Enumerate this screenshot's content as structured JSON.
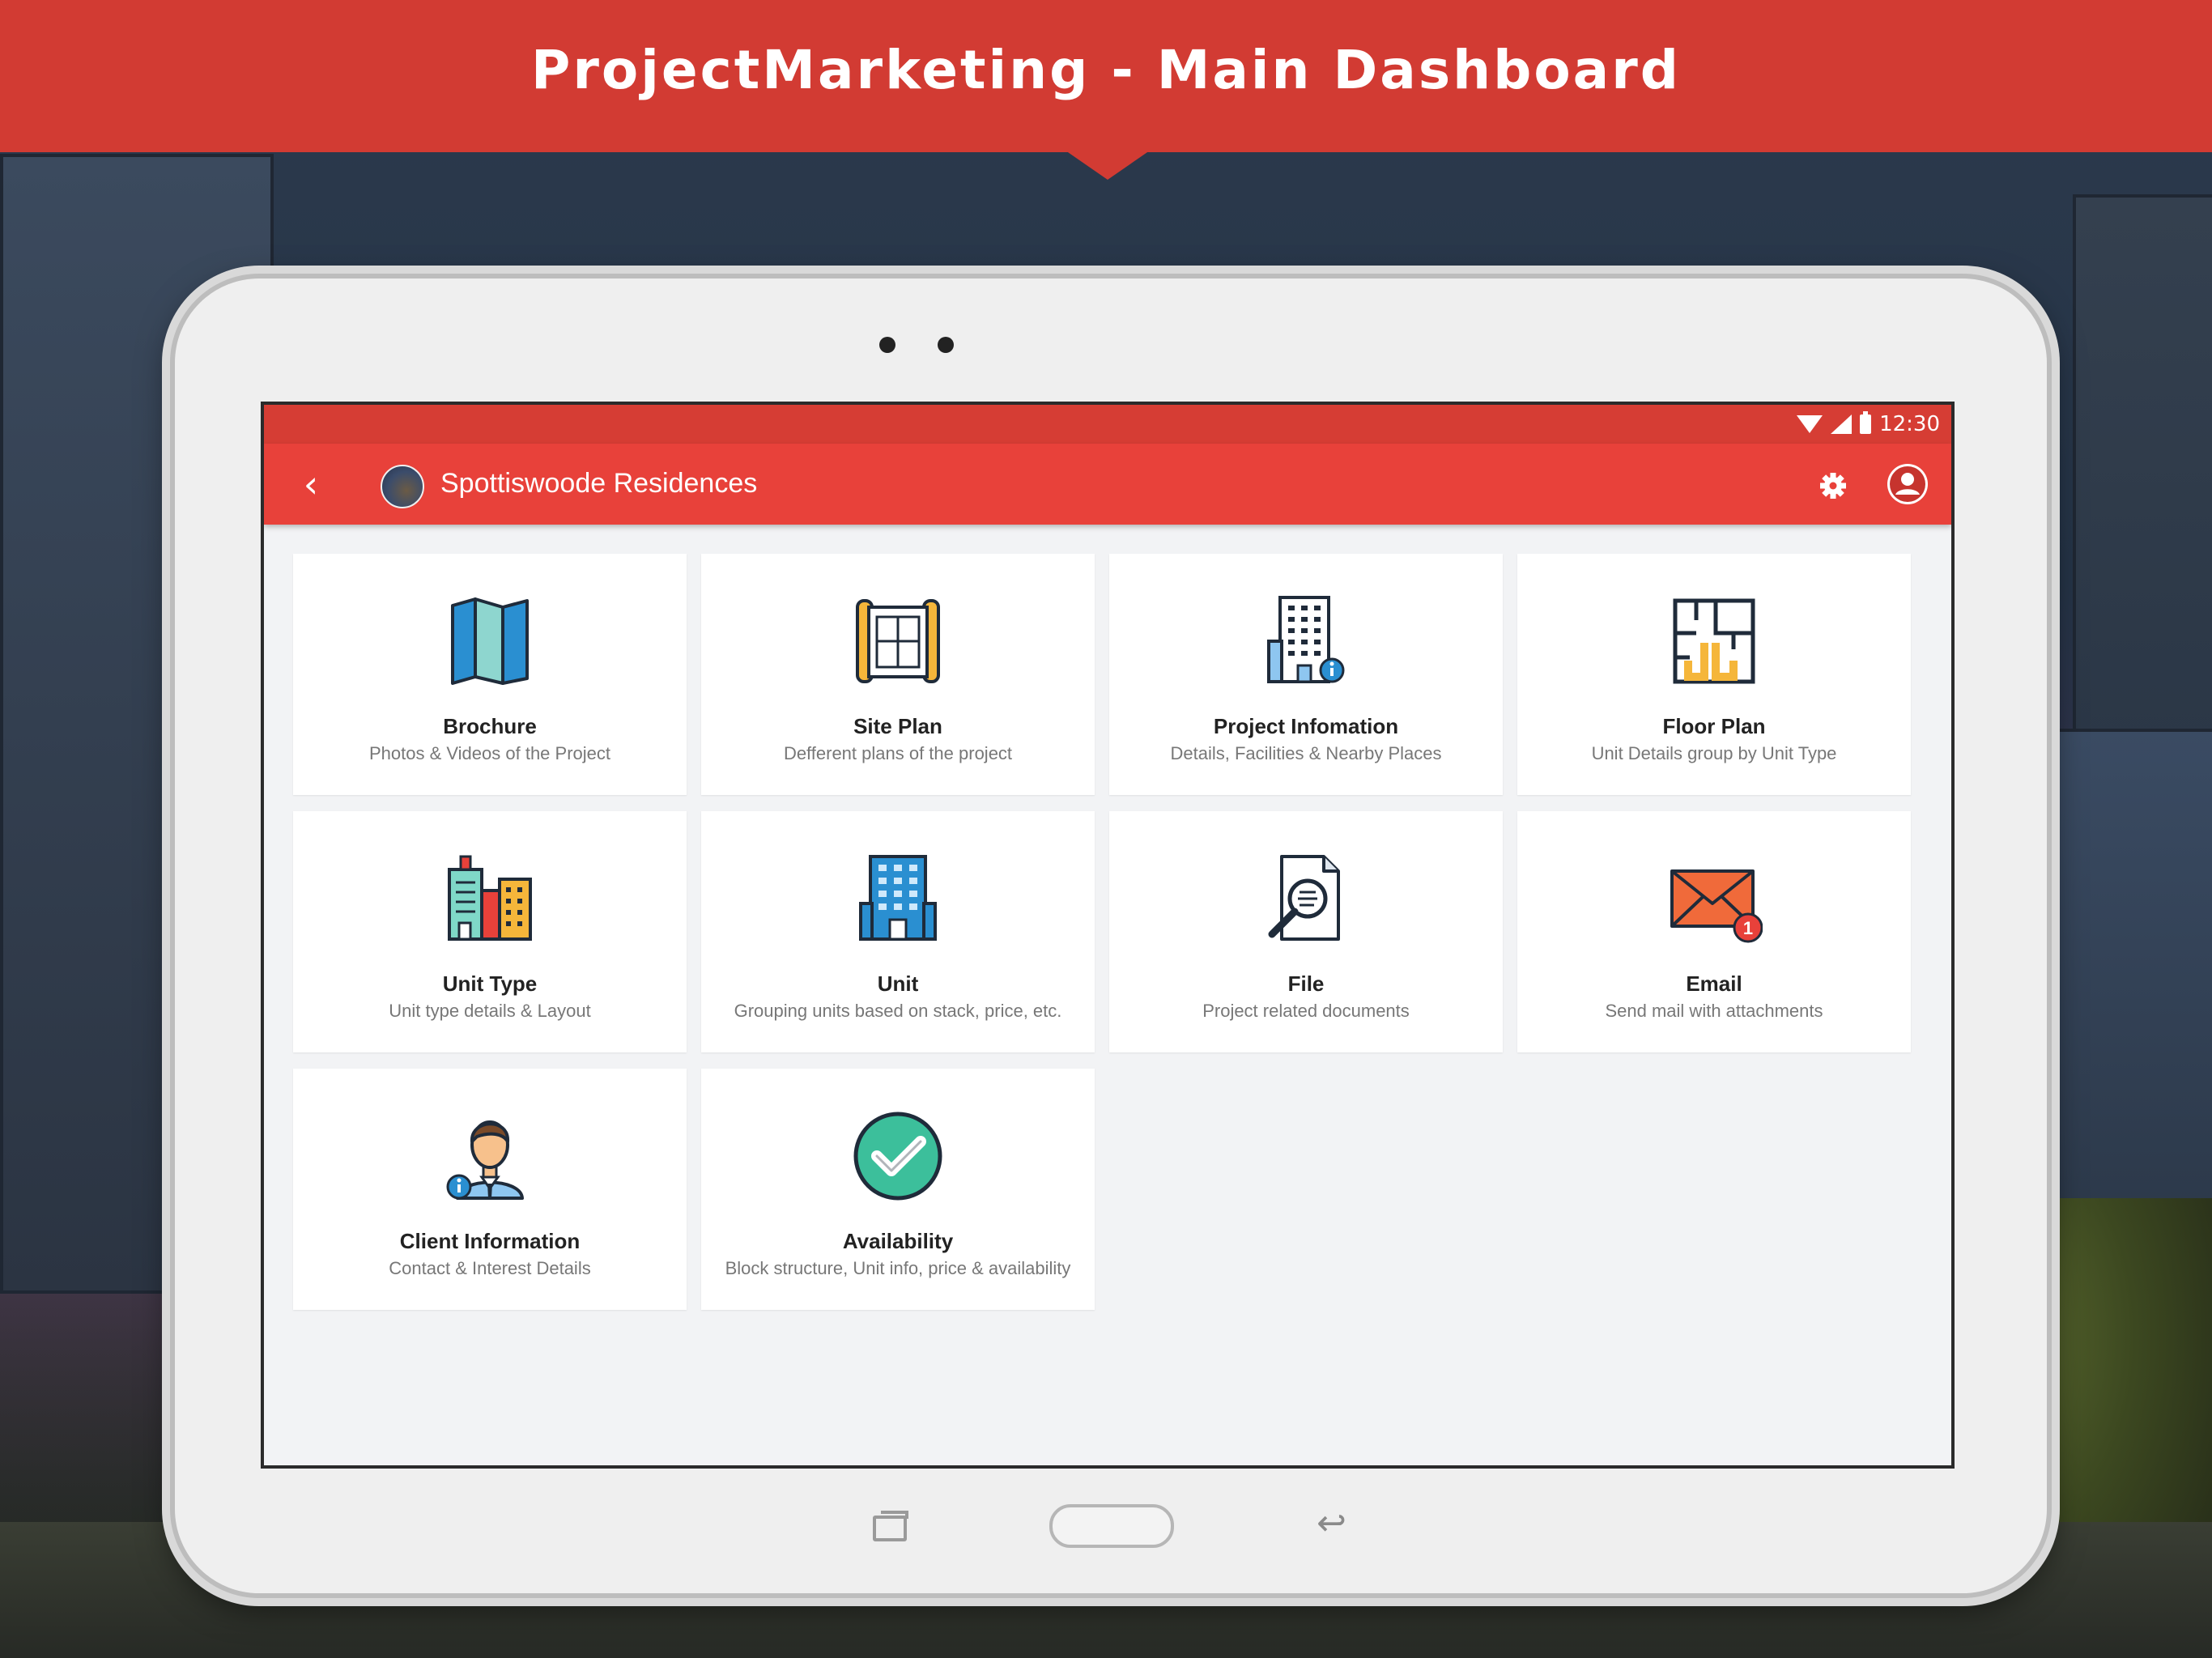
{
  "banner": {
    "title": "ProjectMarketing - Main Dashboard"
  },
  "status_bar": {
    "time": "12:30"
  },
  "app_bar": {
    "title": "Spottiswoode Residences",
    "back_icon": "chevron-left-icon",
    "settings_icon": "gear-icon",
    "account_icon": "user-account-icon"
  },
  "colors": {
    "primary": "#e8413a",
    "status": "#d63d34",
    "banner": "#d23b33"
  },
  "tiles": [
    {
      "title": "Brochure",
      "subtitle": "Photos & Videos of the Project",
      "icon": "map-brochure-icon"
    },
    {
      "title": "Site Plan",
      "subtitle": "Defferent plans of the project",
      "icon": "blueprint-icon"
    },
    {
      "title": "Project Infomation",
      "subtitle": "Details, Facilities & Nearby Places",
      "icon": "building-info-icon"
    },
    {
      "title": "Floor Plan",
      "subtitle": "Unit Details group by Unit Type",
      "icon": "floor-plan-icon"
    },
    {
      "title": "Unit Type",
      "subtitle": "Unit type details & Layout",
      "icon": "city-buildings-icon"
    },
    {
      "title": "Unit",
      "subtitle": "Grouping units based on stack, price, etc.",
      "icon": "office-tower-icon"
    },
    {
      "title": "File",
      "subtitle": "Project related documents",
      "icon": "document-search-icon"
    },
    {
      "title": "Email",
      "subtitle": "Send mail with attachments",
      "icon": "envelope-badge-icon"
    },
    {
      "title": "Client Information",
      "subtitle": "Contact & Interest Details",
      "icon": "client-person-icon"
    },
    {
      "title": "Availability",
      "subtitle": "Block structure, Unit info, price & availability",
      "icon": "check-circle-icon"
    }
  ],
  "email_badge": "1"
}
